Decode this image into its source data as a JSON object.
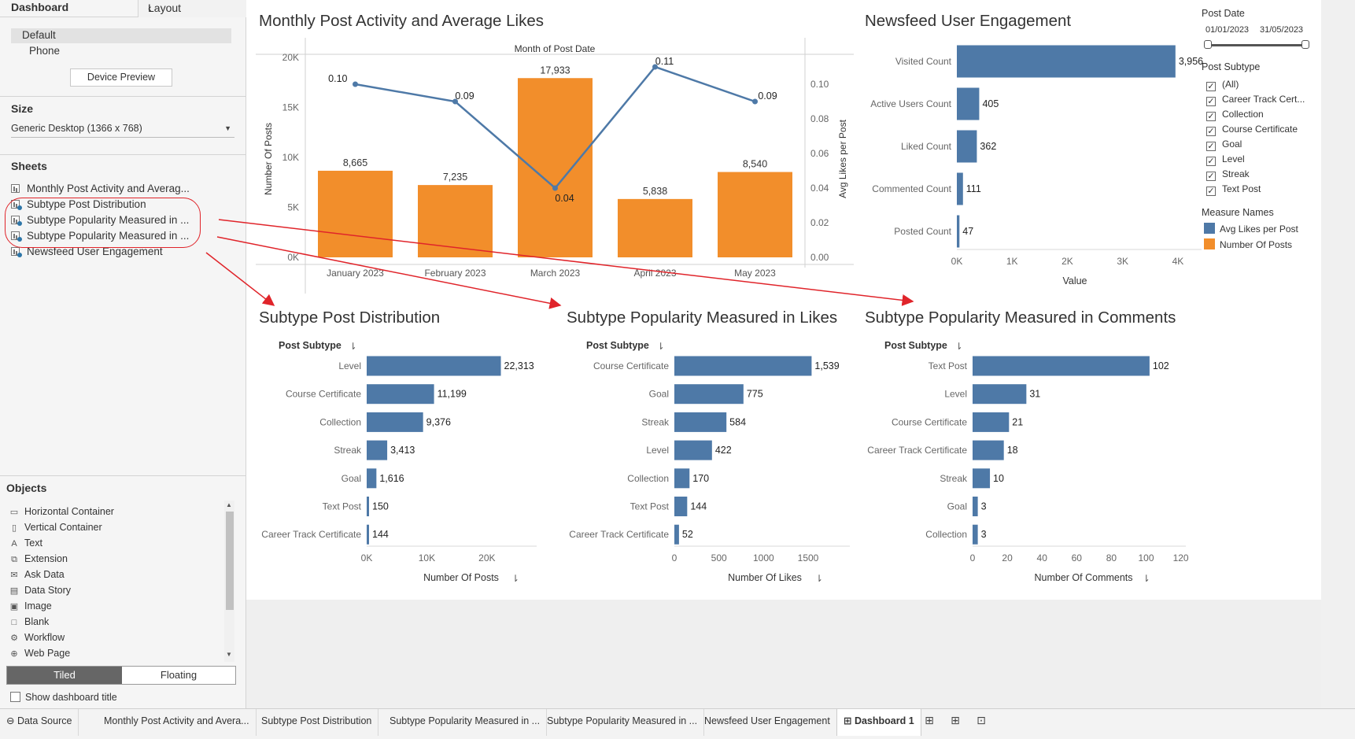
{
  "left_panel": {
    "tab_dashboard": "Dashboard",
    "tab_layout": "Layout",
    "device_default": "Default",
    "device_phone": "Phone",
    "device_preview_button": "Device Preview",
    "size_title": "Size",
    "size_value": "Generic Desktop (1366 x 768)",
    "sheets_title": "Sheets",
    "sheets": [
      "Monthly Post Activity and Averag...",
      "Subtype Post Distribution",
      "Subtype Popularity Measured in ...",
      "Subtype Popularity Measured in ...",
      "Newsfeed User Engagement"
    ],
    "objects_title": "Objects",
    "objects": [
      {
        "label": "Horizontal Container",
        "icon": "horizontal-container-icon",
        "glyph": "▭"
      },
      {
        "label": "Vertical Container",
        "icon": "vertical-container-icon",
        "glyph": "▯"
      },
      {
        "label": "Text",
        "icon": "text-icon",
        "glyph": "A"
      },
      {
        "label": "Extension",
        "icon": "extension-icon",
        "glyph": "⧉"
      },
      {
        "label": "Ask Data",
        "icon": "ask-data-icon",
        "glyph": "✉"
      },
      {
        "label": "Data Story",
        "icon": "data-story-icon",
        "glyph": "▤"
      },
      {
        "label": "Image",
        "icon": "image-icon",
        "glyph": "▣"
      },
      {
        "label": "Blank",
        "icon": "blank-icon",
        "glyph": "□"
      },
      {
        "label": "Workflow",
        "icon": "workflow-icon",
        "glyph": "⚙"
      },
      {
        "label": "Web Page",
        "icon": "web-page-icon",
        "glyph": "⊕"
      }
    ],
    "tiled": "Tiled",
    "floating": "Floating",
    "show_dashboard_title": "Show dashboard title"
  },
  "titles": {
    "monthly": "Monthly Post Activity and Average Likes",
    "newsfeed": "Newsfeed User Engagement",
    "distribution": "Subtype Post Distribution",
    "likes": "Subtype Popularity Measured in Likes",
    "comments": "Subtype Popularity Measured in Comments"
  },
  "filters": {
    "post_date_title": "Post Date",
    "date_start": "01/01/2023",
    "date_end": "31/05/2023",
    "subtype_title": "Post Subtype",
    "subtypes": [
      "(All)",
      "Career Track Cert...",
      "Collection",
      "Course Certificate",
      "Goal",
      "Level",
      "Streak",
      "Text Post"
    ],
    "measure_names_title": "Measure Names",
    "measure_names": [
      {
        "label": "Avg Likes per Post",
        "color": "#4e79a7"
      },
      {
        "label": "Number Of Posts",
        "color": "#f28e2b"
      }
    ]
  },
  "colors": {
    "blue": "#4e79a7",
    "orange": "#f28e2b",
    "annotation": "#e0242a"
  },
  "chart_data": [
    {
      "type": "bar",
      "id": "monthly",
      "title": "Monthly Post Activity and Average Likes",
      "header": "Month of Post Date",
      "categories": [
        "January 2023",
        "February 2023",
        "March 2023",
        "April 2023",
        "May 2023"
      ],
      "bar_series": {
        "name": "Number Of Posts",
        "values": [
          8665,
          7235,
          17933,
          5838,
          8540
        ],
        "labels": [
          "8,665",
          "7,235",
          "17,933",
          "5,838",
          "8,540"
        ]
      },
      "line_series": {
        "name": "Avg Likes per Post",
        "values": [
          0.1,
          0.09,
          0.04,
          0.11,
          0.09
        ],
        "labels": [
          "0.10",
          "0.09",
          "0.04",
          "0.11",
          "0.09"
        ]
      },
      "ylabel": "Number Of Posts",
      "ylabel_right": "Avg Likes per Post",
      "ylim": [
        0,
        20000
      ],
      "ylim_right": [
        0,
        0.11
      ],
      "yticks": [
        0,
        5000,
        10000,
        15000,
        20000
      ],
      "ytick_labels": [
        "0K",
        "5K",
        "10K",
        "15K",
        "20K"
      ],
      "yticks_right": [
        0,
        0.02,
        0.04,
        0.06,
        0.08,
        0.1
      ],
      "ytick_labels_right": [
        "0.00",
        "0.02",
        "0.04",
        "0.06",
        "0.08",
        "0.10"
      ]
    },
    {
      "type": "bar",
      "id": "newsfeed",
      "orientation": "horizontal",
      "title": "Newsfeed User Engagement",
      "categories": [
        "Visited Count",
        "Active Users Count",
        "Liked Count",
        "Commented Count",
        "Posted Count"
      ],
      "values": [
        3956,
        405,
        362,
        111,
        47
      ],
      "labels": [
        "3,956",
        "405",
        "362",
        "111",
        "47"
      ],
      "xlabel": "Value",
      "xlim": [
        0,
        4400
      ],
      "xticks": [
        0,
        1000,
        2000,
        3000,
        4000
      ],
      "xtick_labels": [
        "0K",
        "1K",
        "2K",
        "3K",
        "4K"
      ]
    },
    {
      "type": "bar",
      "id": "distribution",
      "orientation": "horizontal",
      "title": "Subtype Post Distribution",
      "row_header": "Post Subtype",
      "categories": [
        "Level",
        "Course Certificate",
        "Collection",
        "Streak",
        "Goal",
        "Text Post",
        "Career Track Certificate"
      ],
      "values": [
        22313,
        11199,
        9376,
        3413,
        1616,
        150,
        144
      ],
      "labels": [
        "22,313",
        "11,199",
        "9,376",
        "3,413",
        "1,616",
        "150",
        "144"
      ],
      "xlabel": "Number Of Posts",
      "xlim": [
        0,
        28000
      ],
      "xticks": [
        0,
        10000,
        20000
      ],
      "xtick_labels": [
        "0K",
        "10K",
        "20K"
      ]
    },
    {
      "type": "bar",
      "id": "likes",
      "orientation": "horizontal",
      "title": "Subtype Popularity Measured in Likes",
      "row_header": "Post Subtype",
      "categories": [
        "Course Certificate",
        "Goal",
        "Streak",
        "Level",
        "Collection",
        "Text Post",
        "Career Track Certificate"
      ],
      "values": [
        1539,
        775,
        584,
        422,
        170,
        144,
        52
      ],
      "labels": [
        "1,539",
        "775",
        "584",
        "422",
        "170",
        "144",
        "52"
      ],
      "xlabel": "Number Of Likes",
      "xlim": [
        0,
        1950
      ],
      "xticks": [
        0,
        500,
        1000,
        1500
      ],
      "xtick_labels": [
        "0",
        "500",
        "1000",
        "1500"
      ]
    },
    {
      "type": "bar",
      "id": "comments",
      "orientation": "horizontal",
      "title": "Subtype Popularity Measured in Comments",
      "row_header": "Post Subtype",
      "categories": [
        "Text Post",
        "Level",
        "Course Certificate",
        "Career Track Certificate",
        "Streak",
        "Goal",
        "Collection"
      ],
      "values": [
        102,
        31,
        21,
        18,
        10,
        3,
        3
      ],
      "labels": [
        "102",
        "31",
        "21",
        "18",
        "10",
        "3",
        "3"
      ],
      "xlabel": "Number Of Comments",
      "xlim": [
        0,
        122
      ],
      "xticks": [
        0,
        20,
        40,
        60,
        80,
        100,
        120
      ],
      "xtick_labels": [
        "0",
        "20",
        "40",
        "60",
        "80",
        "100",
        "120"
      ]
    }
  ],
  "bottom_tabs": [
    "Data Source",
    "Monthly Post Activity and Avera...",
    "Subtype Post Distribution",
    "Subtype Popularity Measured in ...",
    "Subtype Popularity Measured in ...",
    "Newsfeed User Engagement",
    "Dashboard 1"
  ]
}
